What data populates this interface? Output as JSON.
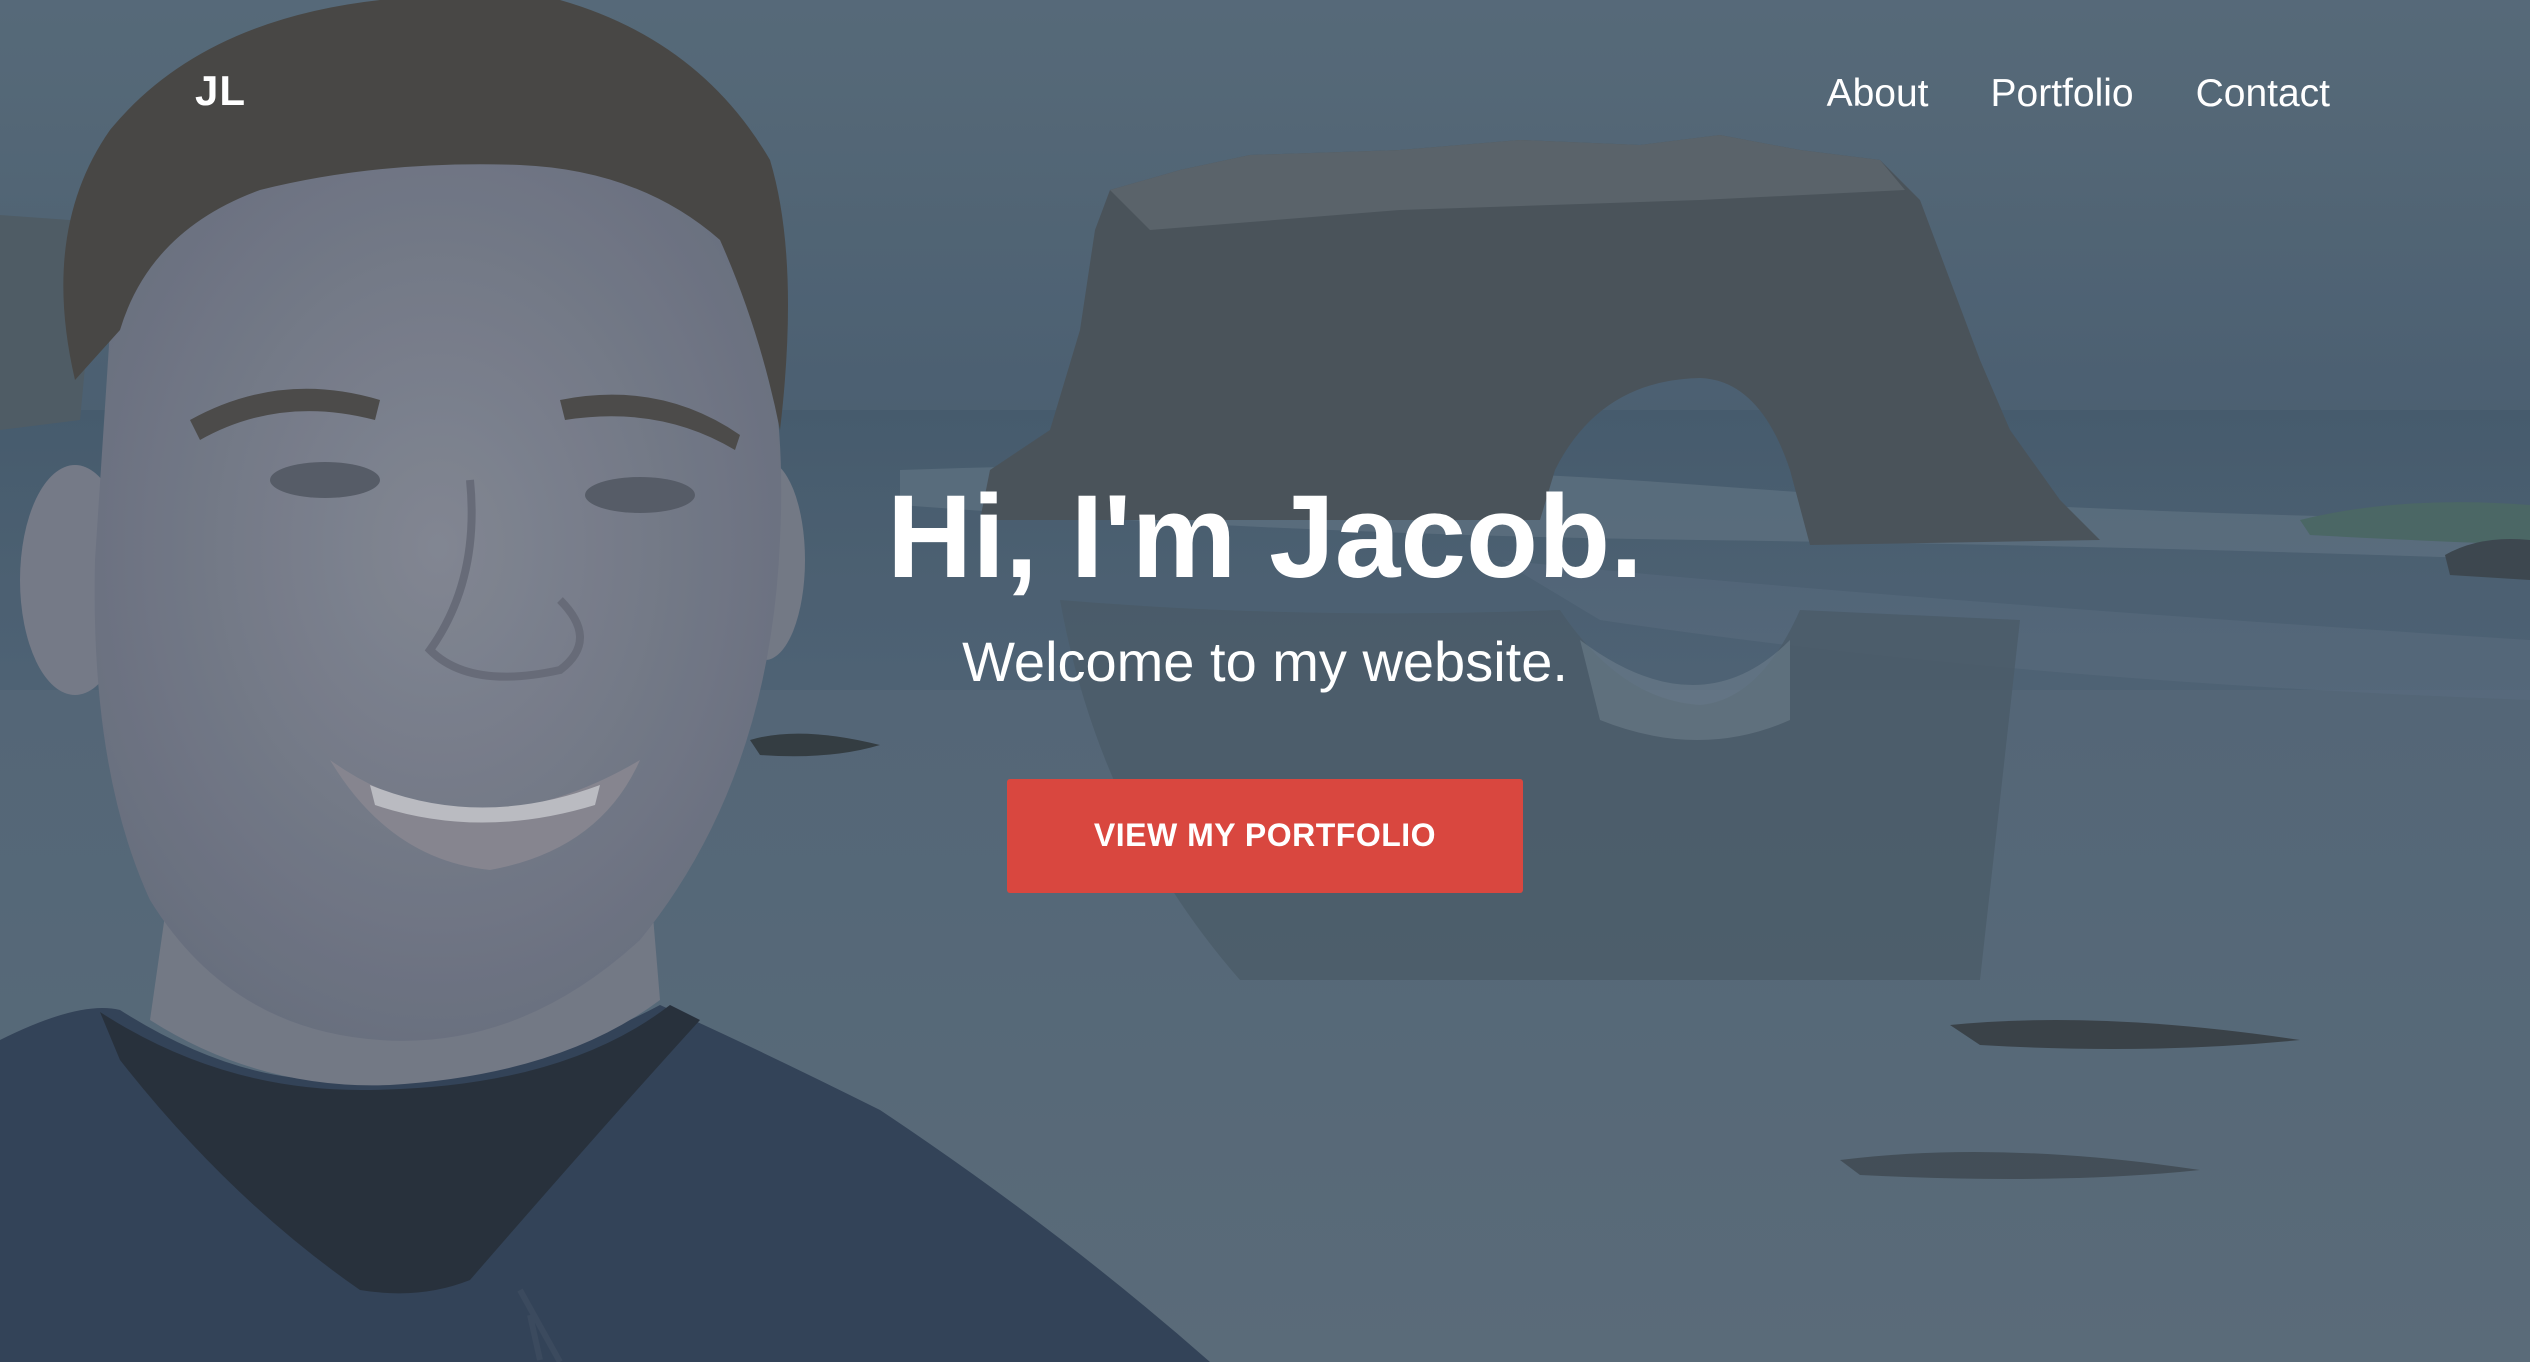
{
  "header": {
    "logo_text": "JL",
    "nav": [
      {
        "label": "About"
      },
      {
        "label": "Portfolio"
      },
      {
        "label": "Contact"
      }
    ]
  },
  "hero": {
    "headline": "Hi, I'm Jacob.",
    "subheadline": "Welcome to my website.",
    "cta_label": "VIEW MY PORTFOLIO"
  },
  "colors": {
    "cta_background": "#d9473f",
    "text": "#ffffff",
    "background_tint": "#4a5b6b"
  }
}
